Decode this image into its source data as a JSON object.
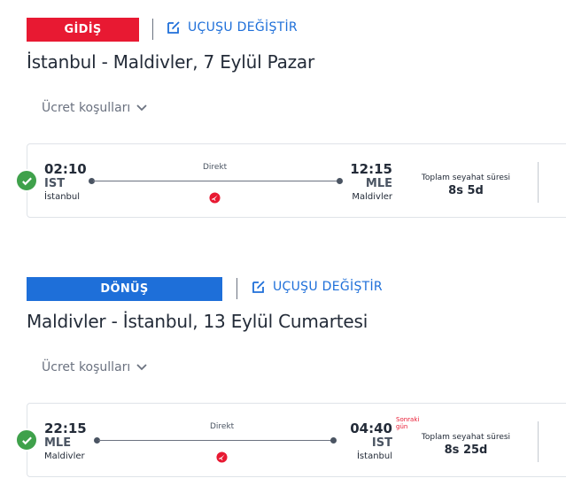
{
  "outbound": {
    "badge": "GİDİŞ",
    "change_label": "UÇUŞU DEĞİŞTİR",
    "route_title": "İstanbul - Maldivler, 7 Eylül Pazar",
    "fare_rules_label": "Ücret koşulları",
    "flight": {
      "dep_time": "02:10",
      "dep_code": "IST",
      "dep_city": "İstanbul",
      "arr_time": "12:15",
      "arr_code": "MLE",
      "arr_city": "Maldivler",
      "stop_type": "Direkt",
      "duration_label": "Toplam seyahat süresi",
      "duration": "8s 5d"
    }
  },
  "return": {
    "badge": "DÖNÜŞ",
    "change_label": "UÇUŞU DEĞİŞTİR",
    "route_title": "Maldivler - İstanbul, 13 Eylül Cumartesi",
    "fare_rules_label": "Ücret koşulları",
    "flight": {
      "dep_time": "22:15",
      "dep_code": "MLE",
      "dep_city": "Maldivler",
      "arr_time": "04:40",
      "arr_code": "IST",
      "arr_city": "İstanbul",
      "next_day_line1": "Sonraki",
      "next_day_line2": "gün",
      "stop_type": "Direkt",
      "duration_label": "Toplam seyahat süresi",
      "duration": "8s 25d"
    }
  },
  "colors": {
    "outbound_badge": "#e81932",
    "return_badge": "#1e6fd9",
    "link": "#1e6fd9",
    "check": "#3fa14b",
    "next_day": "#e81932"
  },
  "icons": {
    "change": "edit-icon",
    "fare": "chevron-down-icon",
    "selected": "check-circle-icon",
    "airline": "airline-logo-icon"
  }
}
